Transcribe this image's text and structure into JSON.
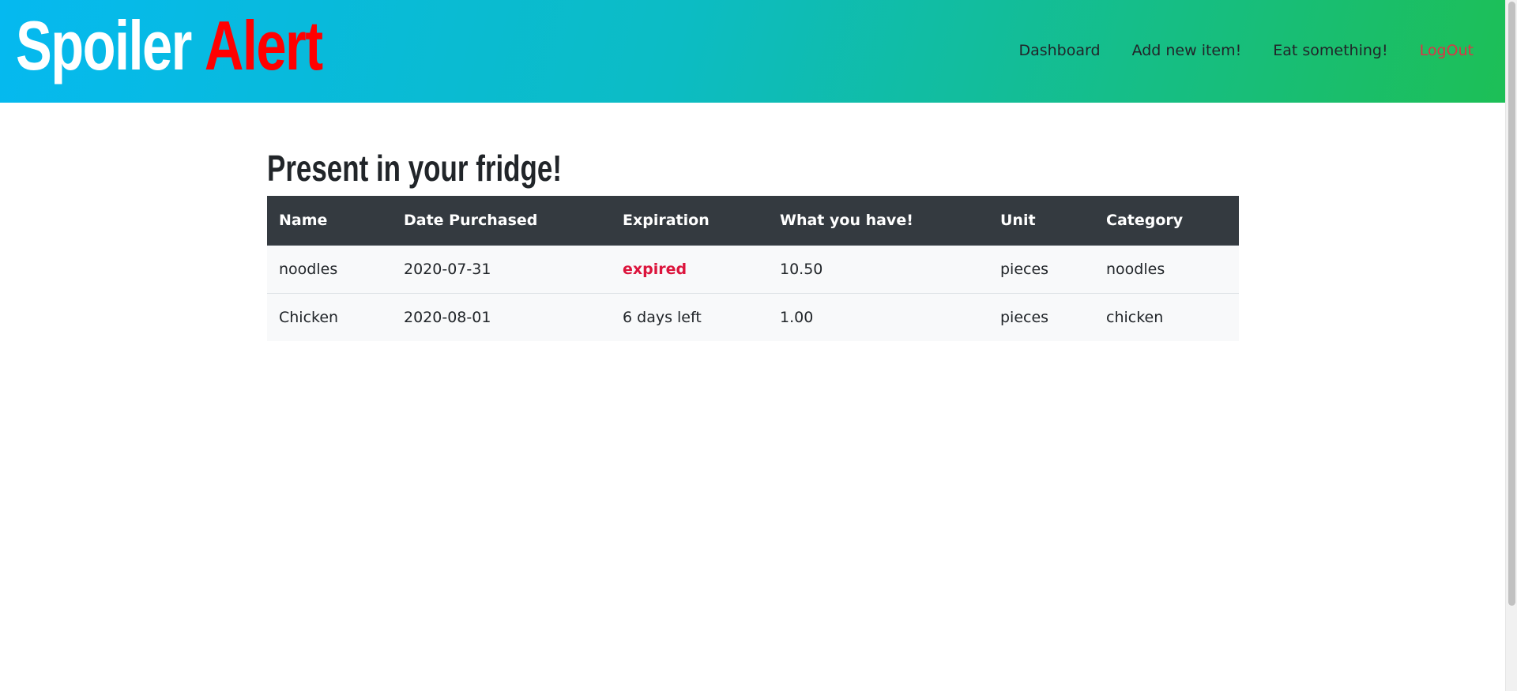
{
  "header": {
    "logo_word1": "Spoiler",
    "logo_word2": "Alert",
    "nav": {
      "dashboard": "Dashboard",
      "add_item": "Add new item!",
      "eat": "Eat something!",
      "logout": "LogOut"
    }
  },
  "main": {
    "title": "Present in your fridge!",
    "table": {
      "columns": [
        "Name",
        "Date Purchased",
        "Expiration",
        "What you have!",
        "Unit",
        "Category"
      ],
      "rows": [
        [
          "noodles",
          "2020-07-31",
          "expired",
          "10.50",
          "pieces",
          "noodles"
        ],
        [
          "Chicken",
          "2020-08-01",
          "6 days left",
          "1.00",
          "pieces",
          "chicken"
        ]
      ]
    }
  },
  "colors": {
    "header_gradient_start": "#05b9f0",
    "header_gradient_end": "#1dbf56",
    "logo_accent": "#ff0000",
    "logout": "#dc3545",
    "expired": "#dc143c",
    "table_header_bg": "#343a40",
    "row_bg": "#f8f9fa"
  }
}
